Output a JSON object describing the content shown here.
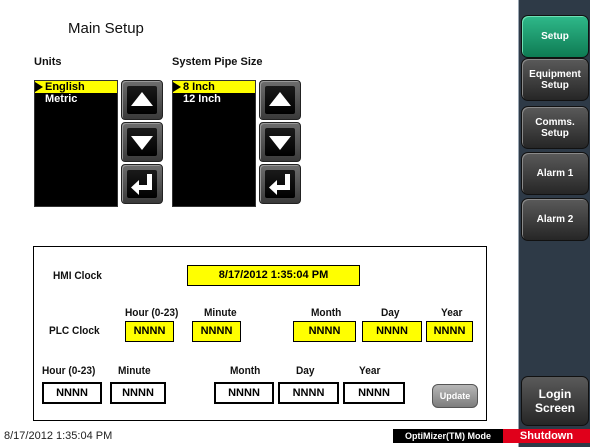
{
  "page": {
    "title": "Main Setup"
  },
  "units": {
    "label": "Units",
    "options": [
      "English",
      "Metric"
    ],
    "selected_index": 0
  },
  "pipe_size": {
    "label": "System Pipe Size",
    "options": [
      "8 Inch",
      "12 Inch"
    ],
    "selected_index": 0
  },
  "clock_panel": {
    "hmi_label": "HMI Clock",
    "hmi_value": "8/17/2012 1:35:04 PM",
    "plc_label": "PLC Clock",
    "headers": {
      "hour": "Hour (0-23)",
      "minute": "Minute",
      "month": "Month",
      "day": "Day",
      "year": "Year"
    },
    "plc_values": {
      "hour": "NNNN",
      "minute": "NNNN",
      "month": "NNNN",
      "day": "NNNN",
      "year": "NNNN"
    },
    "input_values": {
      "hour": "NNNN",
      "minute": "NNNN",
      "month": "NNNN",
      "day": "NNNN",
      "year": "NNNN"
    },
    "update_label": "Update"
  },
  "nav": {
    "setup": "Setup",
    "equipment_setup": "Equipment\nSetup",
    "comms_setup": "Comms.\nSetup",
    "alarm1": "Alarm 1",
    "alarm2": "Alarm 2",
    "login": "Login\nScreen"
  },
  "status_bar": {
    "time": "8/17/2012 1:35:04 PM",
    "mode": "OptiMizer(TM) Mode",
    "shutdown": "Shutdown"
  },
  "colors": {
    "highlight_yellow": "#ffff00",
    "active_nav_green": "#1a9a6a",
    "shutdown_red": "#e0001b",
    "sidebar_bg": "#2e3a47"
  },
  "icons": {
    "up": "up-arrow-icon",
    "down": "down-arrow-icon",
    "enter": "enter-return-icon",
    "selector": "selector-triangle-icon"
  }
}
